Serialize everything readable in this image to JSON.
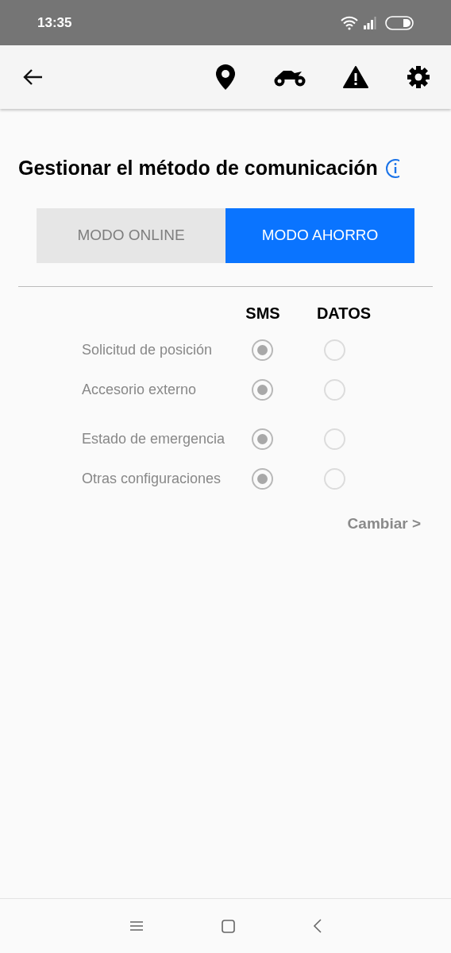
{
  "status_bar": {
    "time": "13:35"
  },
  "title": "Gestionar el método de comunicación",
  "mode_tabs": [
    {
      "label": "MODO ONLINE",
      "selected": false
    },
    {
      "label": "MODO AHORRO",
      "selected": true
    }
  ],
  "columns": [
    "SMS",
    "DATOS"
  ],
  "option_groups": [
    {
      "rows": [
        {
          "label": "Solicitud de posición",
          "disabled": true,
          "options": [
            {
              "selected": true
            },
            {
              "selected": false
            }
          ]
        },
        {
          "label": "Accesorio externo",
          "disabled": true,
          "options": [
            {
              "selected": true
            },
            {
              "selected": false
            }
          ]
        }
      ]
    },
    {
      "rows": [
        {
          "label": "Estado de emergencia",
          "disabled": true,
          "options": [
            {
              "selected": true
            },
            {
              "selected": false
            }
          ]
        },
        {
          "label": "Otras configuraciones",
          "disabled": true,
          "options": [
            {
              "selected": true
            },
            {
              "selected": false
            }
          ]
        }
      ]
    }
  ],
  "change_link": "Cambiar >"
}
